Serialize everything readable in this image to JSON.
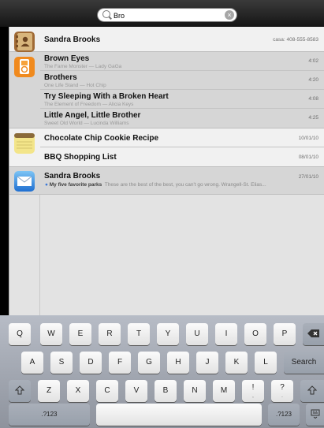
{
  "search": {
    "query": "Bro",
    "clear_icon": "clear-icon"
  },
  "contacts": [
    {
      "name": "Sandra Brooks",
      "phone": "casa: 408-555-8583"
    }
  ],
  "songs": [
    {
      "title": "Brown Eyes",
      "subtitle": "The Fame Monster — Lady GaGa",
      "duration": "4:02"
    },
    {
      "title": "Brothers",
      "subtitle": "One Life Stand — Hot Chip",
      "duration": "4:20"
    },
    {
      "title": "Try Sleeping With a Broken Heart",
      "subtitle": "The Element of Freedom — Alicia Keys",
      "duration": "4:08"
    },
    {
      "title": "Little Angel, Little Brother",
      "subtitle": "Sweet Old World — Lucinda Williams",
      "duration": "4:25"
    }
  ],
  "notes": [
    {
      "title": "Chocolate Chip Cookie Recipe",
      "date": "10/01/10"
    },
    {
      "title": "BBQ Shopping List",
      "date": "08/01/10"
    }
  ],
  "mail": [
    {
      "sender": "Sandra Brooks",
      "date": "27/01/10",
      "subject": "My five favorite parks",
      "preview": "These are the best of the best, you can't go wrong. Wrangell-St. Elias..."
    }
  ],
  "keyboard": {
    "row1": [
      "Q",
      "W",
      "E",
      "R",
      "T",
      "Y",
      "U",
      "I",
      "O",
      "P"
    ],
    "row2": [
      "A",
      "S",
      "D",
      "F",
      "G",
      "H",
      "J",
      "K",
      "L"
    ],
    "row3": [
      "Z",
      "X",
      "C",
      "V",
      "B",
      "N",
      "M",
      "!",
      "?"
    ],
    "row3_sub": [
      "",
      "",
      "",
      "",
      "",
      "",
      "",
      ",",
      "."
    ],
    "search_label": "Search",
    "numbers_label": ".?123",
    "backspace_icon": "backspace-icon",
    "shift_icon": "shift-icon",
    "keyboard_icon": "keyboard-hide-icon"
  },
  "colors": {
    "highlight_group": "#d6d6d6",
    "plain_group": "#f1f1f1",
    "keyboard_bg": "#a9aeb8"
  }
}
